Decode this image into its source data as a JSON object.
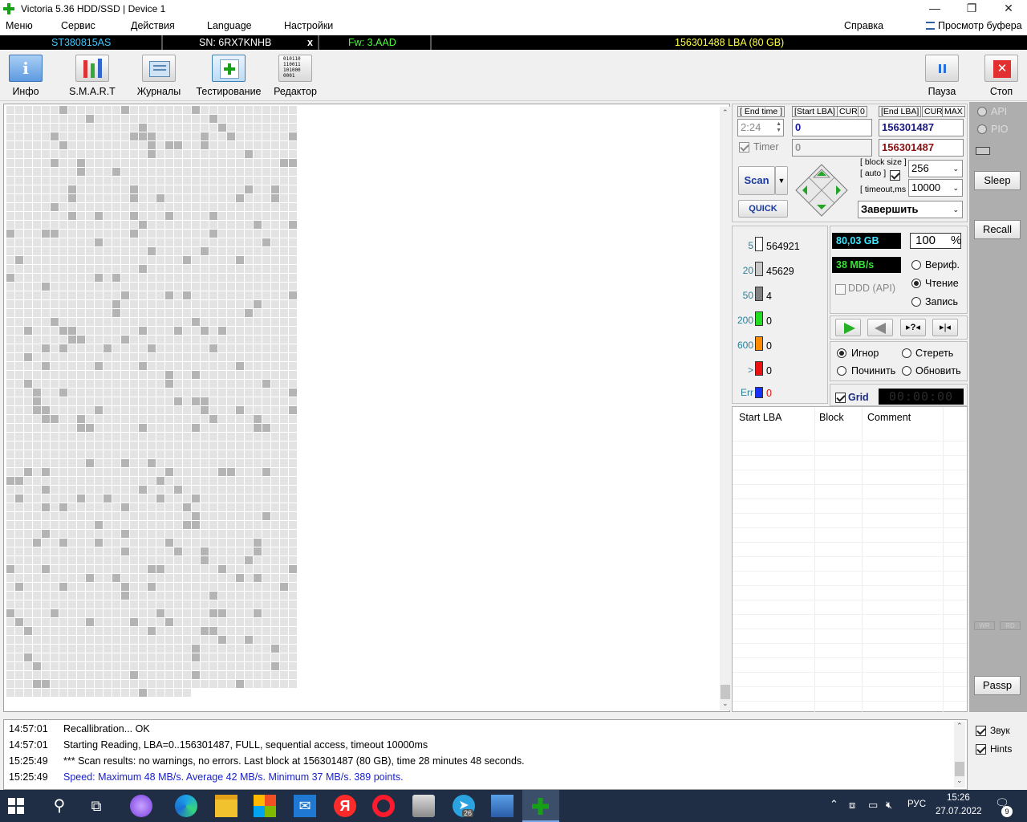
{
  "window": {
    "title": "Victoria 5.36 HDD/SSD | Device 1",
    "buttons": {
      "minimize": "—",
      "restore": "❐",
      "close": "✕"
    }
  },
  "menu": {
    "items": [
      "Меню",
      "Сервис",
      "Действия",
      "Language",
      "Настройки"
    ],
    "help": "Справка",
    "buffer": "Просмотр буфера"
  },
  "drive": {
    "model": "ST380815AS",
    "serial": "SN: 6RX7KNHB",
    "close_mark": "x",
    "firmware": "Fw: 3.AAD",
    "lba": "156301488 LBA (80 GB)",
    "colors": {
      "model": "#3ec8ff",
      "firmware": "#4cff3a",
      "lba": "#ffff3c"
    }
  },
  "toolbar": {
    "info": "Инфо",
    "smart": "S.M.A.R.T",
    "logs": "Журналы",
    "testing": "Тестирование",
    "editor": "Редактор",
    "editor_icon_text": "010110\n110011\n101000\n0001",
    "pause": "Пауза",
    "stop": "Стоп"
  },
  "scan": {
    "end_time_label": "[ End time ]",
    "start_lba_label": "[Start LBA]",
    "cur_label": "CUR",
    "zero_label": "0",
    "end_lba_label": "[End LBA]",
    "max_label": "MAX",
    "end_time_value": "2:24",
    "start_lba_value": "0",
    "end_lba_value": "156301487",
    "timer_label": "Timer",
    "timer_value": "0",
    "end_lba_value2": "156301487",
    "scan_button": "Scan",
    "quick_button": "QUICK",
    "block_size_label": "[ block size ]",
    "auto_label": "[ auto ]",
    "timeout_label": "[ timeout,ms ]",
    "block_size_value": "256",
    "timeout_value": "10000",
    "finish_value": "Завершить"
  },
  "histogram": [
    {
      "label": "5",
      "count": "564921",
      "color": "#ffffff"
    },
    {
      "label": "20",
      "count": "45629",
      "color": "#c8c8c8"
    },
    {
      "label": "50",
      "count": "4",
      "color": "#808080"
    },
    {
      "label": "200",
      "count": "0",
      "color": "#22dd22"
    },
    {
      "label": "600",
      "count": "0",
      "color": "#ff8c00"
    },
    {
      "label": ">",
      "count": "0",
      "color": "#ee1111"
    },
    {
      "label": "Err",
      "count": "0",
      "color": "#1830ff"
    }
  ],
  "stats": {
    "size": "80,03 GB",
    "percent_value": "100",
    "percent_sign": "%",
    "speed": "38 MB/s",
    "ddd": "DDD (API)",
    "verify": "Вериф.",
    "read": "Чтение",
    "write": "Запись"
  },
  "actions": {
    "ignore": "Игнор",
    "erase": "Стереть",
    "repair": "Починить",
    "refresh": "Обновить",
    "grid": "Grid",
    "timer_display": "00:00:00"
  },
  "table": {
    "columns": [
      "Start LBA",
      "Block",
      "Comment"
    ]
  },
  "side": {
    "api": "API",
    "pio": "PIO",
    "sleep": "Sleep",
    "recall": "Recall",
    "wr": "WR",
    "rd": "RD",
    "passp": "Passp",
    "sound": "Звук",
    "hints": "Hints"
  },
  "log": [
    {
      "time": "14:57:01",
      "text": "Recallibration... OK",
      "color": "#000000"
    },
    {
      "time": "14:57:01",
      "text": "Starting Reading, LBA=0..156301487, FULL, sequential access, timeout 10000ms",
      "color": "#000000"
    },
    {
      "time": "15:25:49",
      "text": "*** Scan results: no warnings, no errors. Last block at 156301487 (80 GB), time 28 minutes 48 seconds.",
      "color": "#000000"
    },
    {
      "time": "15:25:49",
      "text": "Speed: Maximum 48 MB/s. Average 42 MB/s. Minimum 37 MB/s. 389 points.",
      "color": "#1a22c8"
    }
  ],
  "taskbar": {
    "lang": "РУС",
    "time": "15:26",
    "date": "27.07.2022",
    "telegram_badge": "26",
    "notif_count": "9"
  }
}
